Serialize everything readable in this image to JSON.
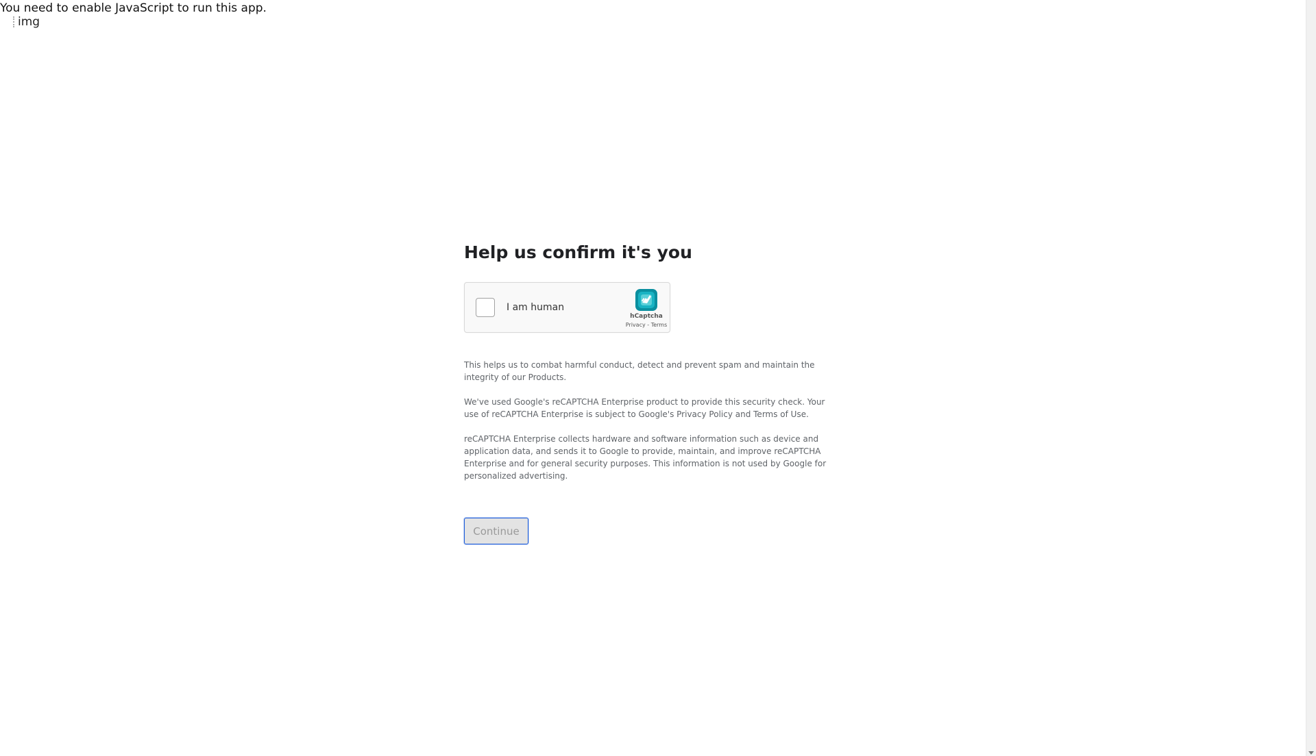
{
  "noscript": {
    "message": "You need to enable JavaScript to run this app."
  },
  "header": {
    "image_alt": "img"
  },
  "main": {
    "title": "Help us confirm it's you",
    "captcha": {
      "checkbox_label": "I am human",
      "brand": "hCaptcha",
      "privacy_link": "Privacy",
      "separator": " - ",
      "terms_link": "Terms",
      "logo_icon": "hcaptcha-logo-icon",
      "accent_color": "#0a8f9f"
    },
    "paragraphs": [
      "This helps us to combat harmful conduct, detect and prevent spam and maintain the integrity of our Products.",
      "We've used Google's reCAPTCHA Enterprise product to provide this security check. Your use of reCAPTCHA Enterprise is subject to Google's Privacy Policy and Terms of Use.",
      "reCAPTCHA Enterprise collects hardware and software information such as device and application data, and sends it to Google to provide, maintain, and improve reCAPTCHA Enterprise and for general security purposes. This information is not used by Google for personalized advertising."
    ],
    "continue_label": "Continue"
  }
}
